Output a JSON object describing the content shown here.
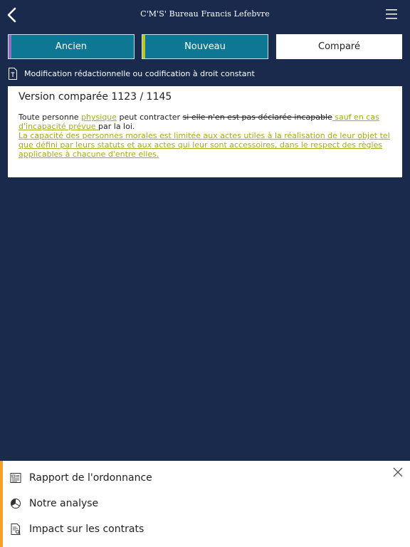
{
  "header": {
    "logo_brand": "C'M'S'",
    "logo_name": "Bureau Francis Lefebvre"
  },
  "tabs": [
    {
      "label": "Ancien"
    },
    {
      "label": "Nouveau"
    },
    {
      "label": "Comparé"
    }
  ],
  "modification": {
    "text": "Modification rédactionnelle ou codification à droit constant"
  },
  "card": {
    "title": "Version comparée 1123 / 1145",
    "text_1": "Toute personne ",
    "ins_1": "physique",
    "text_2": " peut contracter ",
    "del_1": "si elle n'en est pas déclarée incapable",
    "ins_2": " sauf en cas d'incapacité prévue ",
    "text_3": "par la loi.",
    "ins_3": "La capacité des personnes morales est limitée aux actes utiles à la réalisation de leur objet tel que défini par leurs statuts et aux actes qui leur sont accessoires, dans le respect des règles applicables à chacune d'entre elles."
  },
  "panel": {
    "items": [
      {
        "label": "Rapport de l'ordonnance",
        "icon": "report-icon"
      },
      {
        "label": "Notre analyse",
        "icon": "analysis-icon"
      },
      {
        "label": "Impact sur les contrats",
        "icon": "contract-impact-icon"
      }
    ]
  },
  "colors": {
    "background": "#1a2a4c",
    "tab_active_bg": "#0e7794",
    "ancien_accent": "#9b6ac2",
    "nouveau_accent": "#b9c52a",
    "inserted_text": "#a4ab1c",
    "panel_accent": "#f0a22a"
  }
}
